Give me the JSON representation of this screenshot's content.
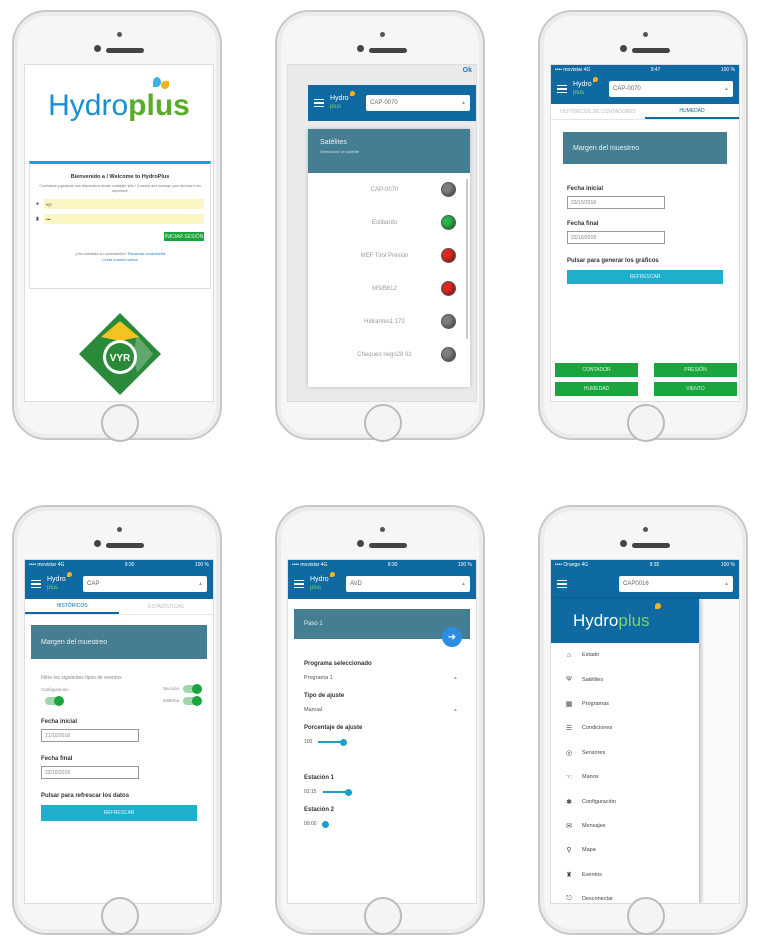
{
  "phone1": {
    "logo": {
      "hydro": "Hydro",
      "plus": "plus"
    },
    "login": {
      "title": "Bienvenido a / Welcome to HydroPlus",
      "description": "Conéctese y gestione sus dispositivos desde cualquier sitio / Connect and manage your devices from anywhere",
      "user_value": "vyr",
      "password_value": "•••",
      "button": "Iniciar sesión",
      "forgot": "¿Ha olvidado su contraseña?",
      "forgot_link": "Recordar contraseña",
      "forgot_link2": "Crear cuenta nueva"
    },
    "brand_logo": "VYR"
  },
  "phone2": {
    "ok_label": "Ok",
    "app_logo": {
      "line1": "Hydro",
      "line2": "plus"
    },
    "selector_value": "CAP-0070",
    "header": {
      "title": "Satélites",
      "subtitle": "Seleccione un satélite"
    },
    "stations": [
      {
        "name": "CAP-0070",
        "status": "gray"
      },
      {
        "name": "Estibardo",
        "status": "green"
      },
      {
        "name": "MEF Tirol Presión",
        "status": "red"
      },
      {
        "name": "MS/B612",
        "status": "red"
      },
      {
        "name": "Hidrantes1 172",
        "status": "gray"
      },
      {
        "name": "Chequeo riego28 01",
        "status": "gray"
      }
    ]
  },
  "phone3": {
    "status": {
      "left": "•••• movistar 4G",
      "time": "9:47",
      "right": "100 %"
    },
    "app_logo": {
      "line1": "Hydro",
      "line2": "plus"
    },
    "selector_value": "CAP-0070",
    "tabs": [
      "Históricos de contadores",
      "Humedad"
    ],
    "section_title": "Margen del muestreo",
    "fecha_inicial_label": "Fecha inicial",
    "fecha_inicial_value": "23/10/2018",
    "fecha_final_label": "Fecha final",
    "fecha_final_value": "23/10/2018",
    "prompt": "Pulsar para generar los gráficos",
    "refresh": "Refrescar",
    "buttons": [
      "Contador",
      "Presión",
      "Humedad",
      "Viento"
    ]
  },
  "phone4": {
    "status": {
      "left": "•••• movistar 4G",
      "time": "9:30",
      "right": "100 %"
    },
    "app_logo": {
      "line1": "Hydro",
      "line2": "plus"
    },
    "selector_value": "CAP",
    "tabs": [
      "Históricos",
      "Estadísticas"
    ],
    "section_title": "Margen del muestreo",
    "instruction": "Filtre los siguientes tipos de eventos",
    "toggles": [
      {
        "label": "Configuración",
        "on": true
      },
      {
        "label": "Sección",
        "on": true
      },
      {
        "label": "Sistema",
        "on": true
      }
    ],
    "fecha_inicial_label": "Fecha inicial",
    "fecha_inicial_value": "21/10/2018",
    "fecha_final_label": "Fecha final",
    "fecha_final_value": "23/10/2018",
    "prompt": "Pulsar para refrescar los datos",
    "refresh": "Refrescar"
  },
  "phone5": {
    "status": {
      "left": "•••• movistar 4G",
      "time": "9:30",
      "right": "100 %"
    },
    "app_logo": {
      "line1": "Hydro",
      "line2": "plus"
    },
    "selector_value": "AVD",
    "step": "Paso 1",
    "fab_icon": "arrow-right",
    "programa_label": "Programa seleccionado",
    "programa_value": "Programa 1",
    "tipo_label": "Tipo de ajuste",
    "tipo_value": "Manual",
    "porcentaje_label": "Porcentaje de ajuste",
    "porcentaje_value": "100",
    "estacion1_label": "Estación 1",
    "estacion1_value": "02:15",
    "estacion2_label": "Estación 2",
    "estacion2_value": "00:00"
  },
  "phone6": {
    "status": {
      "left": "•••• Orange 4G",
      "time": "9:35",
      "right": "100 %"
    },
    "selector_value": "CAP0016",
    "brand": {
      "hydro": "Hydro",
      "plus": "plus"
    },
    "menu": [
      {
        "label": "Estado",
        "icon": "home-icon",
        "glyph": "⌂"
      },
      {
        "label": "Satélites",
        "icon": "antenna-icon",
        "glyph": "Ψ"
      },
      {
        "label": "Programas",
        "icon": "calendar-icon",
        "glyph": "▦"
      },
      {
        "label": "Condiciones",
        "icon": "list-icon",
        "glyph": "☰"
      },
      {
        "label": "Sensores",
        "icon": "sensor-icon",
        "glyph": "◎"
      },
      {
        "label": "Manos",
        "icon": "hand-icon",
        "glyph": "☜"
      },
      {
        "label": "Configuración",
        "icon": "gear-icon",
        "glyph": "✱"
      },
      {
        "label": "Mensajes",
        "icon": "mail-icon",
        "glyph": "✉"
      },
      {
        "label": "Mapa",
        "icon": "map-pin-icon",
        "glyph": "⚲"
      },
      {
        "label": "Eventos",
        "icon": "bell-icon",
        "glyph": "♜"
      },
      {
        "label": "Desconectar",
        "icon": "logout-icon",
        "glyph": "⎋"
      }
    ]
  }
}
